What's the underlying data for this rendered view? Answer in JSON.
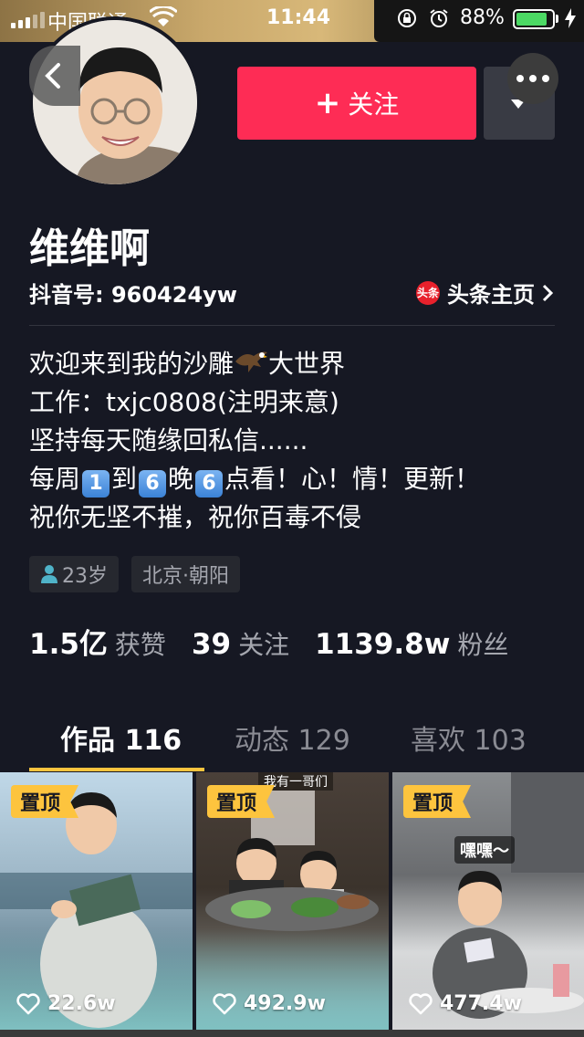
{
  "status_bar": {
    "carrier": "中国联通",
    "time": "11:44",
    "battery": "88%",
    "battery_level": 0.88
  },
  "header": {
    "follow_label": "关注",
    "follow_plus": "+"
  },
  "profile": {
    "name": "维维啊",
    "account_id": "抖音号: 960424yw",
    "toutiao_badge": "头条",
    "toutiao_label": "头条主页",
    "bio": {
      "line1_a": "欢迎来到我的沙雕",
      "line1_b": "大世界",
      "line2": "工作：txjc0808(注明来意)",
      "line3": "坚持每天随缘回私信......",
      "line4_a": "每周",
      "line4_n1": "1",
      "line4_b": "到",
      "line4_n2": "6",
      "line4_c": "晚",
      "line4_n3": "6",
      "line4_d": "点看！心！情！更新！",
      "line5": "祝你无坚不摧，祝你百毒不侵"
    },
    "tags": {
      "age": "23岁",
      "location": "北京·朝阳"
    },
    "stats": {
      "likes_num": "1.5亿",
      "likes_label": "获赞",
      "following_num": "39",
      "following_label": "关注",
      "followers_num": "1139.8w",
      "followers_label": "粉丝"
    }
  },
  "tabs": [
    {
      "label": "作品 116",
      "active": true
    },
    {
      "label": "动态 129",
      "active": false
    },
    {
      "label": "喜欢 103",
      "active": false
    }
  ],
  "videos": [
    {
      "pinned": "置顶",
      "likes": "22.6w"
    },
    {
      "pinned": "置顶",
      "likes": "492.9w",
      "caption": "我有一哥们"
    },
    {
      "pinned": "置顶",
      "likes": "477.4w",
      "caption": "嘿嘿～"
    }
  ],
  "colors": {
    "background": "#161823",
    "accent": "#fe2c55",
    "tab_indicator": "#fdc43e",
    "secondary_text": "#a4a6ae"
  }
}
